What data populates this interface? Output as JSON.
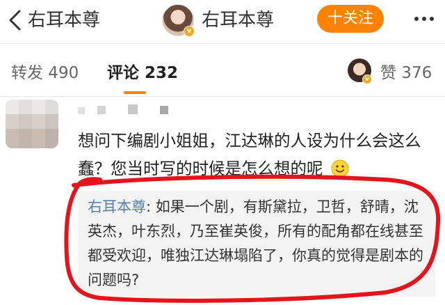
{
  "nav": {
    "left_title": "右耳本尊",
    "center_title": "右耳本尊",
    "follow_label": "十关注",
    "verified_badge": "v"
  },
  "tabs": {
    "repost_label": "转发 490",
    "comment_label": "评论 232",
    "like_label": "赞 376"
  },
  "comment": {
    "text": "想问下编剧小姐姐，江达琳的人设为什么会这么蠢？您当时写的时候是怎么想的呢"
  },
  "reply": {
    "author": "右耳本尊",
    "separator": ": ",
    "text": "如果一个剧，有斯黛拉，卫哲，舒晴，沈英杰，叶东烈，乃至崔英俊，所有的配角都在线甚至都受欢迎，唯独江达琳塌陷了，你真的觉得是剧本的问题吗?"
  },
  "colors": {
    "accent": "#ff8200",
    "link": "#5a7fa6",
    "annotation": "#e3141b"
  }
}
